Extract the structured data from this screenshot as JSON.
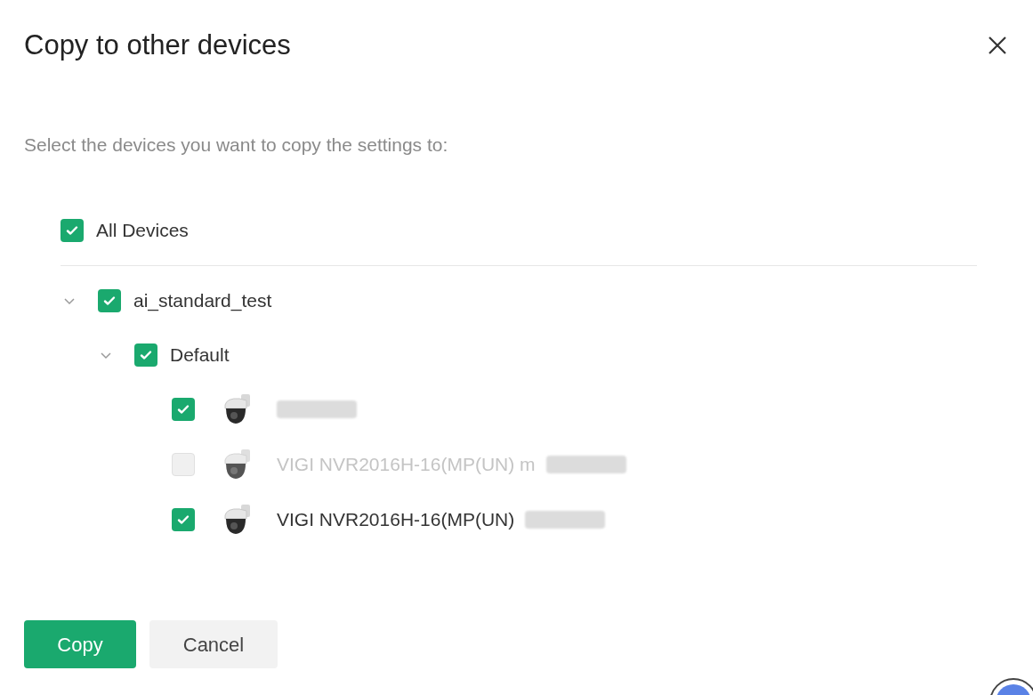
{
  "dialog": {
    "title": "Copy to other devices",
    "instruction": "Select the devices you want to copy the settings to:",
    "all_devices": {
      "label": "All Devices",
      "checked": true
    },
    "tree": [
      {
        "kind": "group",
        "label": "ai_standard_test",
        "checked": true,
        "expanded": true,
        "children": [
          {
            "kind": "group",
            "label": "Default",
            "checked": true,
            "expanded": true,
            "children": [
              {
                "kind": "device",
                "redacted": true,
                "checked": true,
                "disabled": false
              },
              {
                "kind": "device",
                "label": "VIGI NVR2016H-16(MP(UN) m",
                "redacted": true,
                "checked": false,
                "disabled": true
              },
              {
                "kind": "device",
                "label": "VIGI NVR2016H-16(MP(UN)",
                "redacted": true,
                "checked": true,
                "disabled": false
              }
            ]
          }
        ]
      }
    ],
    "buttons": [
      {
        "kind": "primary",
        "label": "Copy"
      },
      {
        "kind": "secondary",
        "label": "Cancel"
      }
    ]
  }
}
